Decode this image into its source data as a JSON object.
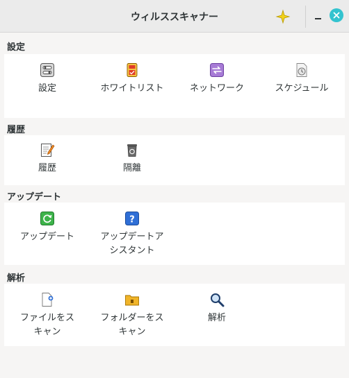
{
  "window": {
    "title": "ウィルススキャナー"
  },
  "sections": [
    {
      "heading": "設定",
      "items": [
        {
          "label": "設定",
          "icon": "settings-toggle-icon"
        },
        {
          "label": "ホワイトリスト",
          "icon": "whitelist-scroll-icon"
        },
        {
          "label": "ネットワーク",
          "icon": "network-arrows-icon"
        },
        {
          "label": "スケジュール",
          "icon": "schedule-clock-icon"
        }
      ]
    },
    {
      "heading": "履歴",
      "items": [
        {
          "label": "履歴",
          "icon": "history-notepad-icon"
        },
        {
          "label": "隔離",
          "icon": "quarantine-trash-icon"
        }
      ]
    },
    {
      "heading": "アップデート",
      "items": [
        {
          "label": "アップデート",
          "icon": "update-refresh-icon"
        },
        {
          "label": "アップデートアシスタント",
          "icon": "help-question-icon"
        }
      ]
    },
    {
      "heading": "解析",
      "items": [
        {
          "label": "ファイルをスキャン",
          "icon": "scan-file-icon"
        },
        {
          "label": "フォルダーをスキャン",
          "icon": "scan-folder-icon"
        },
        {
          "label": "解析",
          "icon": "analysis-magnifier-icon"
        }
      ]
    }
  ],
  "colors": {
    "accent_close": "#33c3cf",
    "sparkle": "#f2d21b"
  }
}
